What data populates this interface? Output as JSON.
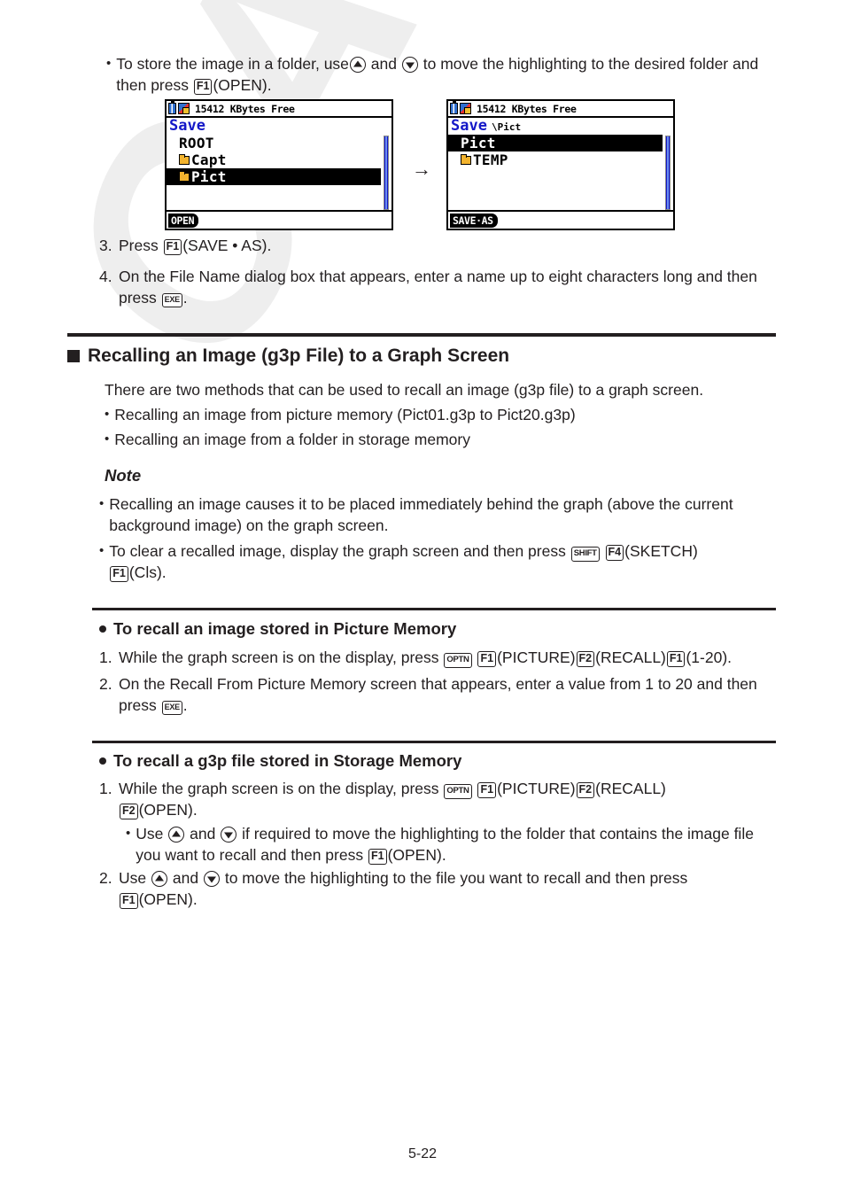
{
  "page": {
    "footer_number": "5-22",
    "watermark_text": "CASIO"
  },
  "intro_bullet": {
    "bullet": "•",
    "text_before_up": "To store the image in a folder, use",
    "and_1": "and",
    "text_after_down": "to move the highlighting to the desired folder and then press",
    "key_f1": "F1",
    "open_label": "(OPEN)."
  },
  "screens": [
    {
      "status_text": "15412 KBytes Free",
      "title": "Save",
      "path": "",
      "items": [
        {
          "label": "ROOT",
          "folder": false,
          "selected": false,
          "indent": true
        },
        {
          "label": "Capt",
          "folder": true,
          "selected": false,
          "indent": true
        },
        {
          "label": "Pict",
          "folder": true,
          "selected": true,
          "indent": true
        }
      ],
      "fkey": "OPEN"
    },
    {
      "status_text": "15412 KBytes Free",
      "title": "Save",
      "path": "\\Pict",
      "items": [
        {
          "label": "Pict",
          "folder": false,
          "selected": true,
          "indent": true
        },
        {
          "label": "TEMP",
          "folder": true,
          "selected": false,
          "indent": true
        }
      ],
      "fkey": "SAVE·AS"
    }
  ],
  "transition_arrow": "→",
  "steps_top": [
    {
      "num": "3.",
      "pre": "Press",
      "key": "F1",
      "post": "(SAVE • AS)."
    },
    {
      "num": "4.",
      "pre": "On the File Name dialog box that appears, enter a name up to eight characters long and then press",
      "key": "EXE",
      "post": "."
    }
  ],
  "section_main": {
    "heading": "Recalling an Image (g3p File) to a Graph Screen",
    "intro": "There are two methods that can be used to recall an image (g3p file) to a graph screen.",
    "bullets": [
      "Recalling an image from picture memory (Pict01.g3p to Pict20.g3p)",
      "Recalling an image from a folder in storage memory"
    ],
    "note_heading": "Note",
    "note_bullets": [
      {
        "text": "Recalling an image causes it to be placed immediately behind the graph (above the current background image) on the graph screen."
      },
      {
        "pre": "To clear a recalled image, display the graph screen and then press",
        "key_shift": "SHIFT",
        "key_f4": "F4",
        "mid": "(SKETCH)",
        "key_f1": "F1",
        "post": "(Cls)."
      }
    ]
  },
  "section_picture_memory": {
    "heading": "To recall an image stored in Picture Memory",
    "steps": [
      {
        "num": "1.",
        "pre": "While the graph screen is on the display, press",
        "key_optn": "OPTN",
        "key_f1": "F1",
        "lbl_picture": "(PICTURE)",
        "key_f2": "F2",
        "lbl_recall": "(RECALL)",
        "key_f1b": "F1",
        "lbl_range": "(1-20)."
      },
      {
        "num": "2.",
        "pre": "On the Recall From Picture Memory screen that appears, enter a value from 1 to 20 and then press",
        "key_exe": "EXE",
        "post": "."
      }
    ]
  },
  "section_storage_memory": {
    "heading": "To recall a g3p file stored in Storage Memory",
    "step1": {
      "num": "1.",
      "pre": "While the graph screen is on the display, press",
      "key_optn": "OPTN",
      "key_f1": "F1",
      "lbl_picture": "(PICTURE)",
      "key_f2": "F2",
      "lbl_recall": "(RECALL)",
      "key_f2b": "F2",
      "lbl_open": "(OPEN)."
    },
    "sub_bullet": {
      "bullet": "•",
      "pre": "Use",
      "and": "and",
      "mid": "if required to move the highlighting to the folder that contains the image file you want to recall and then press",
      "key_f1": "F1",
      "post": "(OPEN)."
    },
    "step2": {
      "num": "2.",
      "pre": "Use",
      "and": "and",
      "mid": "to move the highlighting to the file you want to recall and then press",
      "key_f1": "F1",
      "post": "(OPEN)."
    }
  }
}
